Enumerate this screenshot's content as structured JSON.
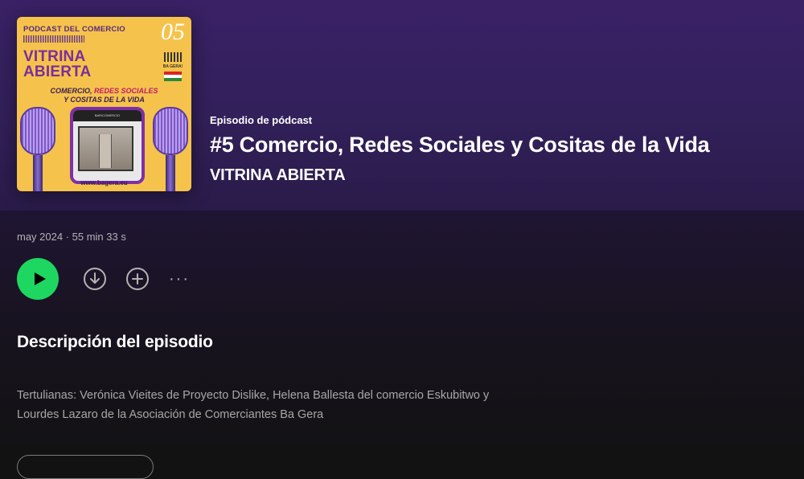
{
  "cover": {
    "podcast_label": "PODCAST DEL COMERCIO",
    "episode_no": "05",
    "title_line1": "VITRINA",
    "title_line2": "ABIERTA",
    "subtitle_part1": "COMERCIO, ",
    "subtitle_highlight": "REDES SOCIALES",
    "subtitle_line2": "Y COSITAS DE LA VIDA",
    "brand": "BA GERA!",
    "shop_sign": "BAR/COMERCIO",
    "website": "www.bagera.eu"
  },
  "header": {
    "type_label": "Episodio de pódcast",
    "title": "#5 Comercio, Redes Sociales y Cositas de la Vida",
    "show_name": "VITRINA ABIERTA"
  },
  "meta": {
    "text": "may 2024 · 55 min 33 s"
  },
  "actions": {
    "play_icon": "play-icon",
    "download_icon": "download-circle-icon",
    "add_icon": "plus-circle-icon",
    "more_icon": "more-dots-icon",
    "more_label": "···"
  },
  "description": {
    "heading": "Descripción del episodio",
    "line1": "Tertulianas: Verónica Vieites de Proyecto Dislike, Helena Ballesta del comercio Eskubitwo y",
    "line2": "Lourdes Lazaro de la Asociación de Comerciantes Ba Gera"
  },
  "colors": {
    "accent_green": "#1ed760",
    "header_purple": "#3a2166",
    "cover_yellow": "#f5c34b"
  }
}
